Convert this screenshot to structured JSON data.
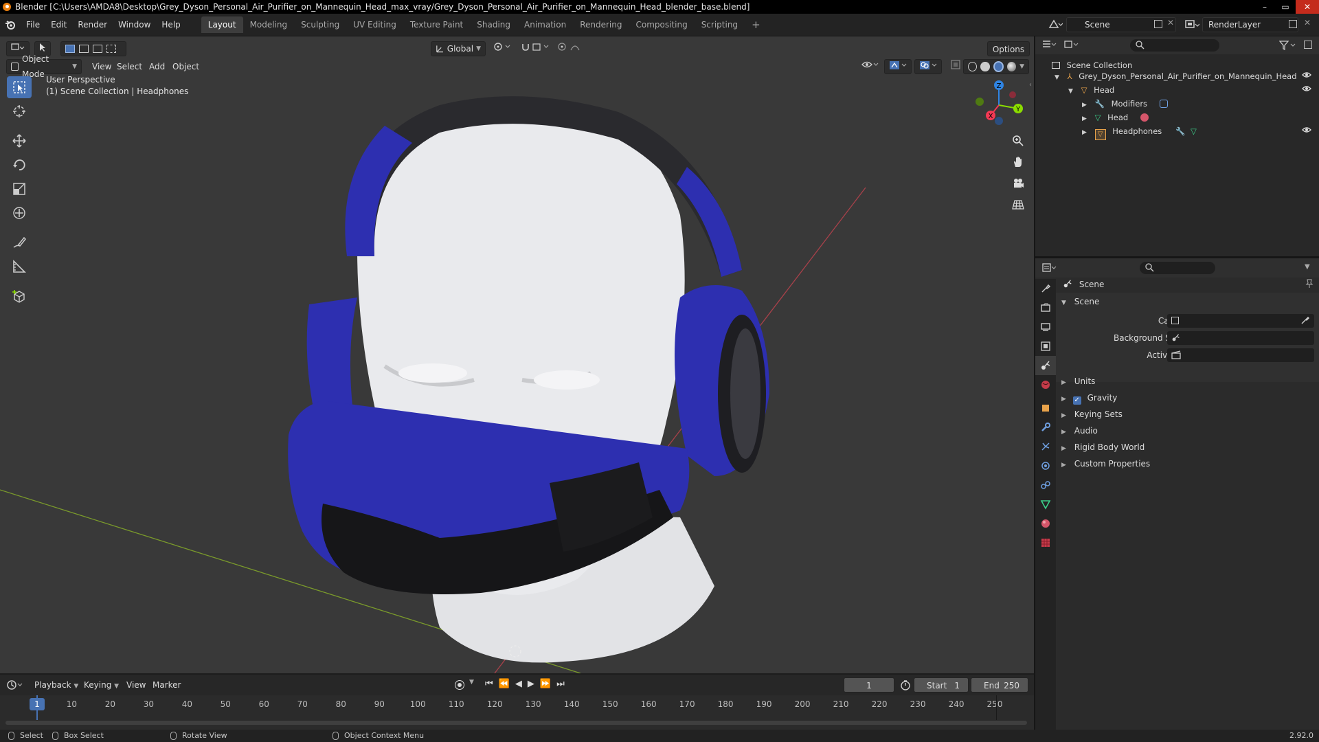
{
  "titlebar": {
    "title": "Blender [C:\\Users\\AMDA8\\Desktop\\Grey_Dyson_Personal_Air_Purifier_on_Mannequin_Head_max_vray/Grey_Dyson_Personal_Air_Purifier_on_Mannequin_Head_blender_base.blend]",
    "minimize": "–",
    "maximize": "▭",
    "close": "✕"
  },
  "menu": [
    "File",
    "Edit",
    "Render",
    "Window",
    "Help"
  ],
  "workspaces": [
    {
      "label": "Layout",
      "active": true
    },
    {
      "label": "Modeling"
    },
    {
      "label": "Sculpting"
    },
    {
      "label": "UV Editing"
    },
    {
      "label": "Texture Paint"
    },
    {
      "label": "Shading"
    },
    {
      "label": "Animation"
    },
    {
      "label": "Rendering"
    },
    {
      "label": "Compositing"
    },
    {
      "label": "Scripting"
    }
  ],
  "add_workspace": "+",
  "scene_selector": {
    "value": "Scene"
  },
  "viewlayer_selector": {
    "value": "RenderLayer"
  },
  "viewport": {
    "mode": "Object Mode",
    "menus": [
      "View",
      "Select",
      "Add",
      "Object"
    ],
    "transform_orientation": "Global",
    "options": "Options",
    "overlay_line1": "User Perspective",
    "overlay_line2": "(1) Scene Collection | Headphones",
    "gizmo": {
      "x": "X",
      "y": "Y",
      "z": "Z"
    },
    "colors": {
      "x": "#f33954",
      "y": "#8bdc00",
      "z": "#2f84e3",
      "bg": "#393939",
      "accent": "#4772b3",
      "head": "#e8e9ec",
      "purifier_blue": "#2d2fb0",
      "dark": "#1c1c1e"
    }
  },
  "outliner": {
    "root": "Scene Collection",
    "items": [
      {
        "label": "Grey_Dyson_Personal_Air_Purifier_on_Mannequin_Head"
      },
      {
        "label": "Head"
      },
      {
        "label": "Modifiers"
      },
      {
        "label": "Head"
      },
      {
        "label": "Headphones"
      }
    ]
  },
  "properties": {
    "header": "Scene",
    "panel": "Scene",
    "fields": [
      {
        "label": "Camera"
      },
      {
        "label": "Background Scene"
      },
      {
        "label": "Active Clip"
      }
    ],
    "subpanels": [
      {
        "label": "Units"
      },
      {
        "label": "Gravity",
        "checked": true
      },
      {
        "label": "Keying Sets"
      },
      {
        "label": "Audio"
      },
      {
        "label": "Rigid Body World"
      },
      {
        "label": "Custom Properties"
      }
    ]
  },
  "timeline": {
    "menus": [
      "Playback",
      "Keying",
      "View",
      "Marker"
    ],
    "current_frame": "1",
    "start_label": "Start",
    "start": "1",
    "end_label": "End",
    "end": "250",
    "ticks": [
      "1",
      "10",
      "20",
      "30",
      "40",
      "50",
      "60",
      "70",
      "80",
      "90",
      "100",
      "110",
      "120",
      "130",
      "140",
      "150",
      "160",
      "170",
      "180",
      "190",
      "200",
      "210",
      "220",
      "230",
      "240",
      "250"
    ]
  },
  "statusbar": {
    "select": "Select",
    "box_select": "Box Select",
    "rotate_view": "Rotate View",
    "context_menu": "Object Context Menu",
    "version": "2.92.0"
  }
}
